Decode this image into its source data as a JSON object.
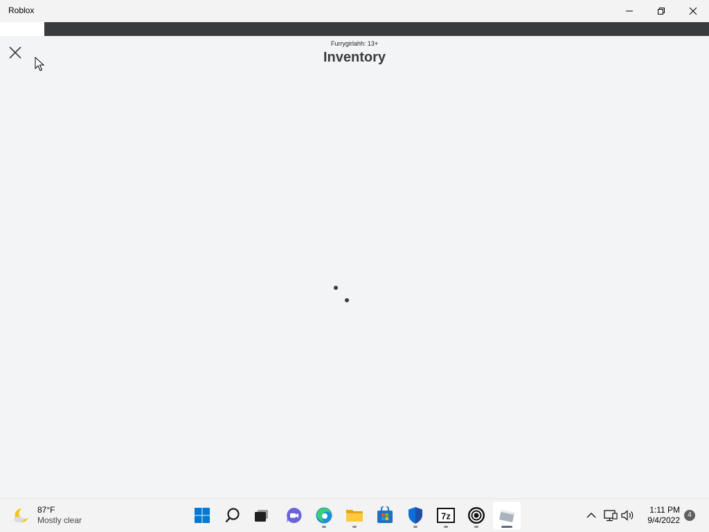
{
  "window": {
    "title": "Roblox"
  },
  "modal": {
    "subtitle": "Furrygirlahh: 13+",
    "title": "Inventory"
  },
  "taskbar": {
    "weather": {
      "temperature": "87°F",
      "condition": "Mostly clear"
    },
    "apps": [
      {
        "name": "Start",
        "icon": "windows-start-icon"
      },
      {
        "name": "Search",
        "icon": "search-icon"
      },
      {
        "name": "Task View",
        "icon": "task-view-icon"
      },
      {
        "name": "Chat",
        "icon": "chat-icon"
      },
      {
        "name": "Microsoft Edge",
        "icon": "edge-icon"
      },
      {
        "name": "File Explorer",
        "icon": "folder-icon"
      },
      {
        "name": "Microsoft Store",
        "icon": "store-icon"
      },
      {
        "name": "Windows Security",
        "icon": "shield-icon"
      },
      {
        "name": "7-Zip",
        "icon": "7zip-icon",
        "label": "7z"
      },
      {
        "name": "OBS",
        "icon": "obs-icon"
      },
      {
        "name": "Roblox",
        "icon": "roblox-icon"
      }
    ],
    "clock": {
      "time": "1:11 PM",
      "date": "9/4/2022"
    },
    "notification_count": "4"
  },
  "colors": {
    "accent": "#393b3d",
    "background": "#f2f4f6",
    "windows_blue": "#0078d4"
  }
}
